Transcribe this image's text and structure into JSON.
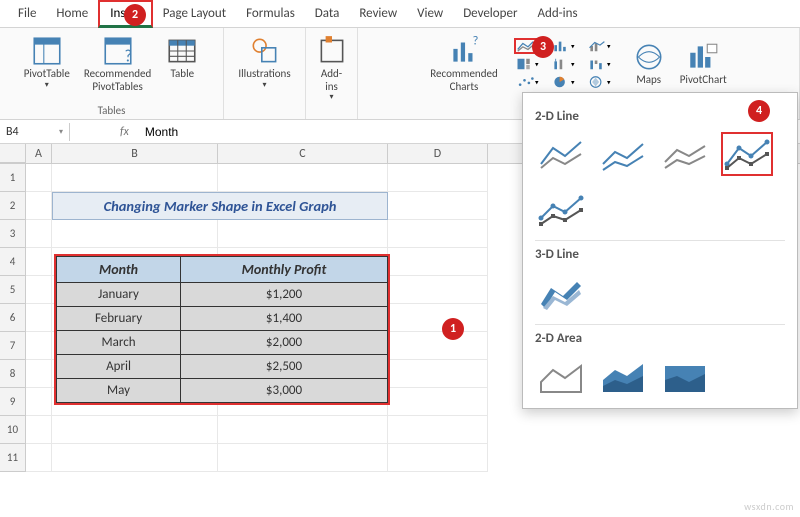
{
  "tabs": [
    "File",
    "Home",
    "Insert",
    "Page Layout",
    "Formulas",
    "Data",
    "Review",
    "View",
    "Developer",
    "Add-ins"
  ],
  "active_tab_index": 2,
  "ribbon": {
    "pivot_table": "PivotTable",
    "rec_pivot": "Recommended\nPivotTables",
    "table": "Table",
    "tables_group": "Tables",
    "illustrations": "Illustrations",
    "addins": "Add-\nins",
    "rec_charts": "Recommended\nCharts",
    "maps": "Maps",
    "pivot_chart": "PivotChart"
  },
  "namebox": "B4",
  "fx": "fx",
  "formula_value": "Month",
  "columns": [
    "A",
    "B",
    "C",
    "D"
  ],
  "rows": [
    "1",
    "2",
    "3",
    "4",
    "5",
    "6",
    "7",
    "8",
    "9",
    "10",
    "11"
  ],
  "title": "Changing Marker Shape in Excel Graph",
  "table": {
    "headers": [
      "Month",
      "Monthly Profit"
    ],
    "rows": [
      [
        "January",
        "$1,200"
      ],
      [
        "February",
        "$1,400"
      ],
      [
        "March",
        "$2,000"
      ],
      [
        "April",
        "$2,500"
      ],
      [
        "May",
        "$3,000"
      ]
    ]
  },
  "panel": {
    "sec1": "2-D Line",
    "sec2": "3-D Line",
    "sec3": "2-D Area"
  },
  "callouts": {
    "c1": "1",
    "c2": "2",
    "c3": "3",
    "c4": "4"
  },
  "watermark": "wsxdn.com",
  "chart_data": {
    "type": "table",
    "title": "Changing Marker Shape in Excel Graph",
    "columns": [
      "Month",
      "Monthly Profit"
    ],
    "rows": [
      [
        "January",
        1200
      ],
      [
        "February",
        1400
      ],
      [
        "March",
        2000
      ],
      [
        "April",
        2500
      ],
      [
        "May",
        3000
      ]
    ],
    "currency": "USD"
  }
}
